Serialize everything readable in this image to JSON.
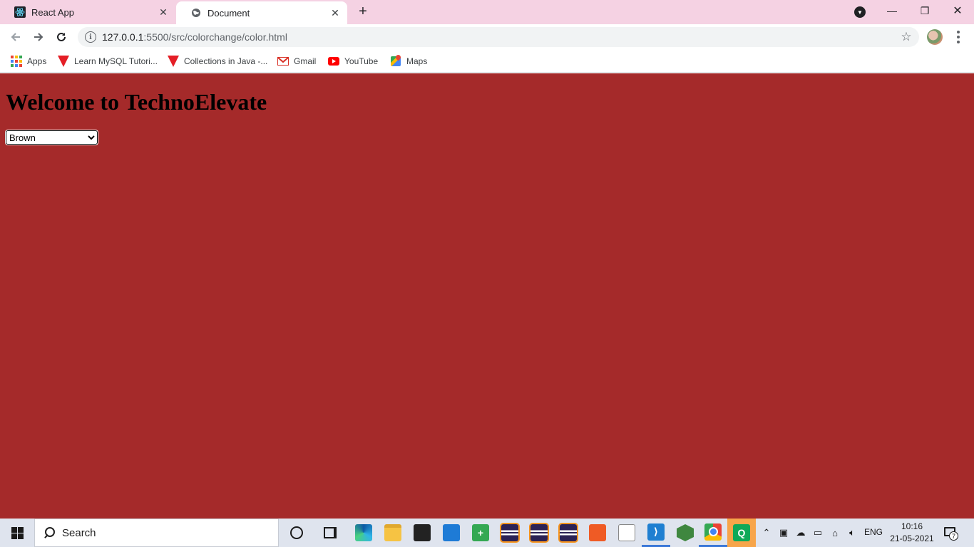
{
  "browser": {
    "tabs": [
      {
        "title": "React App",
        "icon": "react-icon",
        "active": false
      },
      {
        "title": "Document",
        "icon": "globe-icon",
        "active": true
      }
    ],
    "address": {
      "host": "127.0.0.1",
      "path": ":5500/src/colorchange/color.html"
    },
    "bookmarks": [
      {
        "label": "Apps",
        "icon": "apps-grid-icon"
      },
      {
        "label": "Learn MySQL Tutori...",
        "icon": "tutorial-site-icon"
      },
      {
        "label": "Collections in Java -...",
        "icon": "tutorial-site-icon"
      },
      {
        "label": "Gmail",
        "icon": "gmail-icon"
      },
      {
        "label": "YouTube",
        "icon": "youtube-icon"
      },
      {
        "label": "Maps",
        "icon": "maps-icon"
      }
    ]
  },
  "page": {
    "background_color": "#a52a2a",
    "heading": "Welcome to TechnoElevate",
    "color_select": {
      "selected": "Brown"
    }
  },
  "taskbar": {
    "search_placeholder": "Search",
    "language": "ENG",
    "time": "10:16",
    "date": "21-05-2021",
    "notification_count": "7",
    "accent_color": "#3b78d8"
  }
}
